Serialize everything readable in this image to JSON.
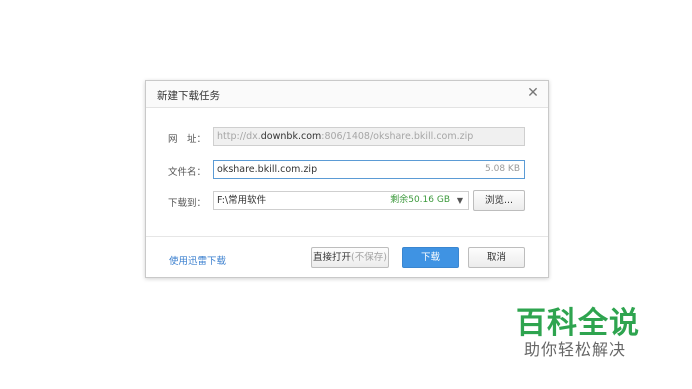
{
  "dialog": {
    "title": "新建下载任务",
    "close_glyph": "✕",
    "url": {
      "label": "网　址：",
      "prefix": "http://dx.",
      "domain": "downbk.com",
      "suffix": ":806/1408/okshare.bkill.com.zip"
    },
    "filename": {
      "label": "文件名：",
      "value": "okshare.bkill.com.zip",
      "size": "5.08 KB"
    },
    "saveto": {
      "label": "下载到：",
      "value": "F:\\常用软件",
      "free_space": "剩余50.16 GB",
      "arrow": "▼",
      "browse_label": "浏览..."
    },
    "footer": {
      "link_label": "使用迅雷下载",
      "open_label": "直接打开",
      "open_hint": "(不保存)",
      "download_label": "下载",
      "cancel_label": "取消"
    }
  },
  "watermark": {
    "title": "百科全说",
    "subtitle": "助你轻松解决"
  },
  "colors": {
    "primary": "#3f93e3",
    "link": "#3a7fcf",
    "free_space": "#3c9a3c",
    "watermark": "#2ea44f"
  }
}
